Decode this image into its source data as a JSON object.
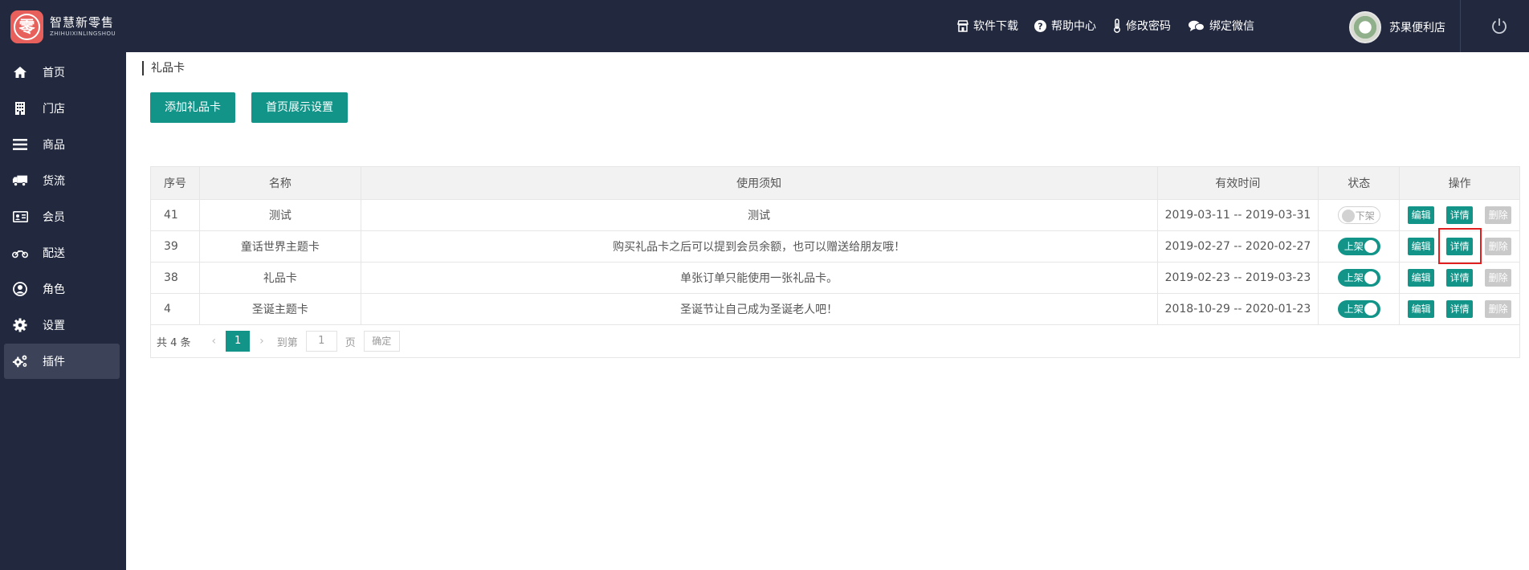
{
  "brand": {
    "logo_glyph": "零",
    "name": "智慧新零售",
    "subtitle": "ZHIHUIXINLINGSHOU"
  },
  "topnav": {
    "download": {
      "label": "软件下载",
      "icon": "store-icon"
    },
    "help": {
      "label": "帮助中心",
      "icon": "question-circle-icon"
    },
    "password": {
      "label": "修改密码",
      "icon": "thermometer-icon"
    },
    "wechat": {
      "label": "绑定微信",
      "icon": "chat-bubbles-icon"
    },
    "user_name": "苏果便利店"
  },
  "sidebar": {
    "items": [
      {
        "label": "首页",
        "icon": "home-icon"
      },
      {
        "label": "门店",
        "icon": "building-icon"
      },
      {
        "label": "商品",
        "icon": "list-icon"
      },
      {
        "label": "货流",
        "icon": "truck-icon"
      },
      {
        "label": "会员",
        "icon": "id-card-icon"
      },
      {
        "label": "配送",
        "icon": "motorcycle-icon"
      },
      {
        "label": "角色",
        "icon": "user-circle-icon"
      },
      {
        "label": "设置",
        "icon": "gear-icon"
      },
      {
        "label": "插件",
        "icon": "gears-icon",
        "active": true
      }
    ]
  },
  "page": {
    "breadcrumb": "礼品卡",
    "add_button": "添加礼品卡",
    "display_button": "首页展示设置"
  },
  "table": {
    "headers": [
      "序号",
      "名称",
      "使用须知",
      "有效时间",
      "状态",
      "操作"
    ],
    "rows": [
      {
        "id": "41",
        "name": "测试",
        "note": "测试",
        "date": "2019-03-11 -- 2019-03-31",
        "status": "下架",
        "on": false
      },
      {
        "id": "39",
        "name": "童话世界主题卡",
        "note": "购买礼品卡之后可以提到会员余额，也可以赠送给朋友哦！",
        "date": "2019-02-27 -- 2020-02-27",
        "status": "上架",
        "on": true
      },
      {
        "id": "38",
        "name": "礼品卡",
        "note": "单张订单只能使用一张礼品卡。",
        "date": "2019-02-23 -- 2019-03-23",
        "status": "上架",
        "on": true
      },
      {
        "id": "4",
        "name": "圣诞主题卡",
        "note": "圣诞节让自己成为圣诞老人吧！",
        "date": "2018-10-29 -- 2020-01-23",
        "status": "上架",
        "on": true
      }
    ],
    "ops": {
      "edit": "编辑",
      "detail": "详情",
      "delete": "删除"
    }
  },
  "pager": {
    "total": "共 4 条",
    "current": "1",
    "goto_label": "到第",
    "goto_value": "1",
    "page_label": "页",
    "confirm": "确定"
  },
  "colors": {
    "sidebar_bg": "#22293f",
    "accent": "#129489",
    "highlight": "#e02020"
  }
}
